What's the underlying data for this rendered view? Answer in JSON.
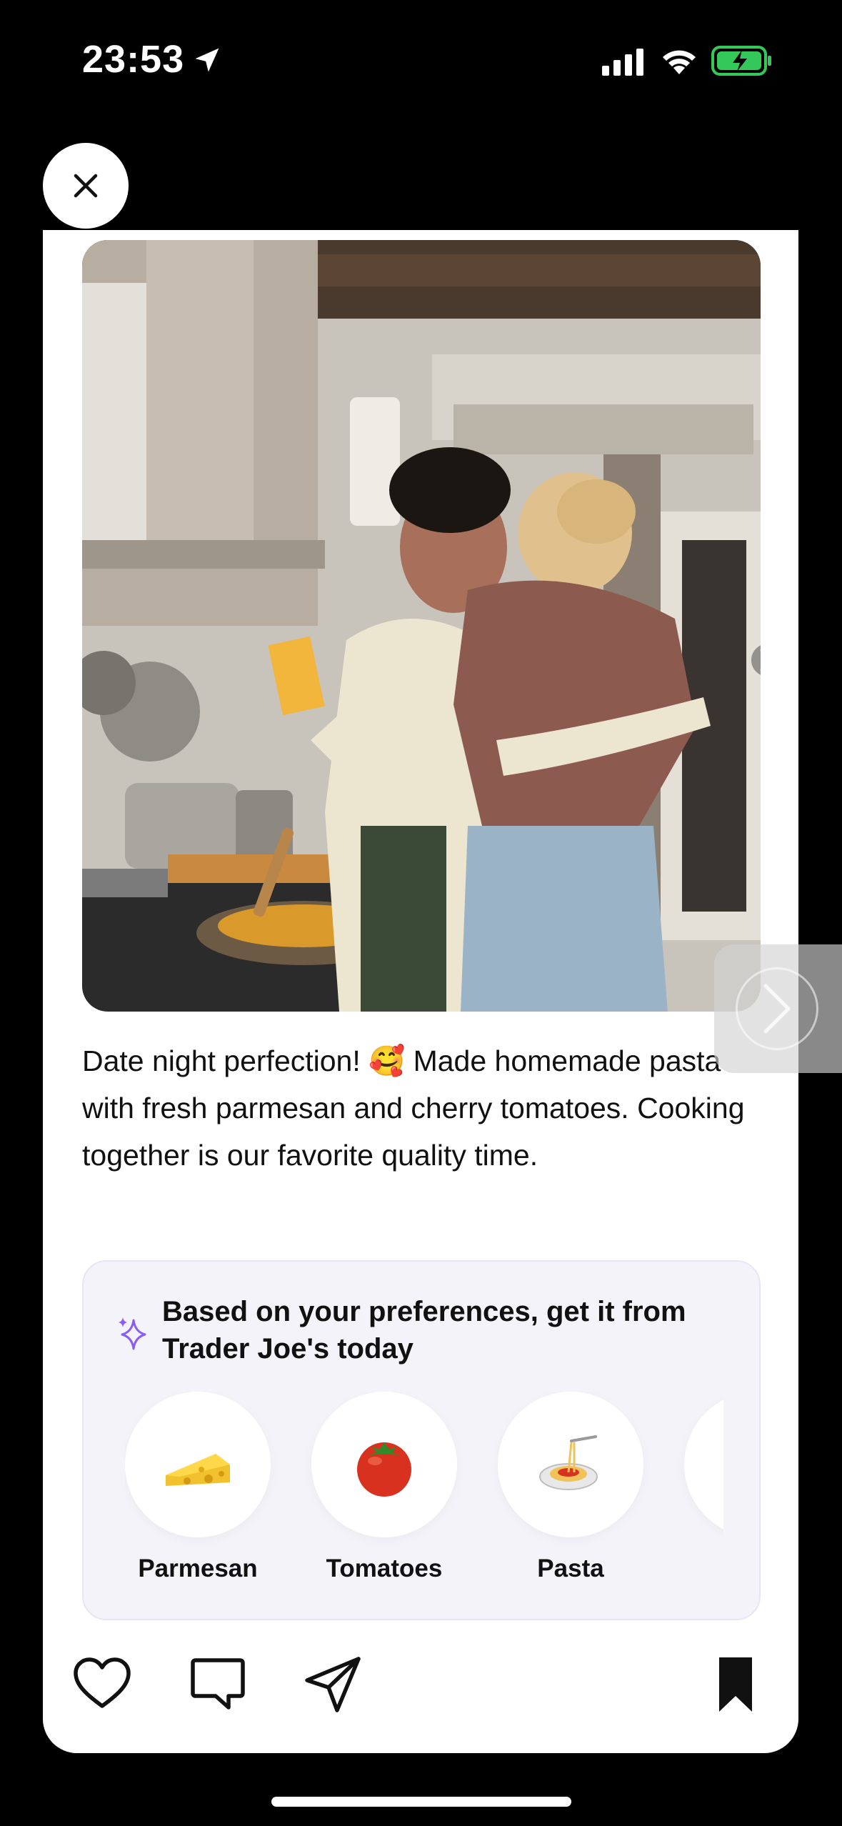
{
  "status_bar": {
    "time": "23:53"
  },
  "post": {
    "caption": "Date night perfection! 🥰 Made homemade pasta with fresh parmesan and cherry tomatoes. Cooking together is our favorite quality time."
  },
  "recommendations": {
    "title": "Based on your preferences, get it from Trader Joe's today",
    "items": [
      {
        "label": "Parmesan",
        "icon": "cheese-icon"
      },
      {
        "label": "Tomatoes",
        "icon": "tomato-icon"
      },
      {
        "label": "Pasta",
        "icon": "spaghetti-icon"
      }
    ]
  },
  "colors": {
    "accent": "#8a5cf6",
    "battery": "#34c759",
    "panel_bg": "#f4f3f9"
  }
}
